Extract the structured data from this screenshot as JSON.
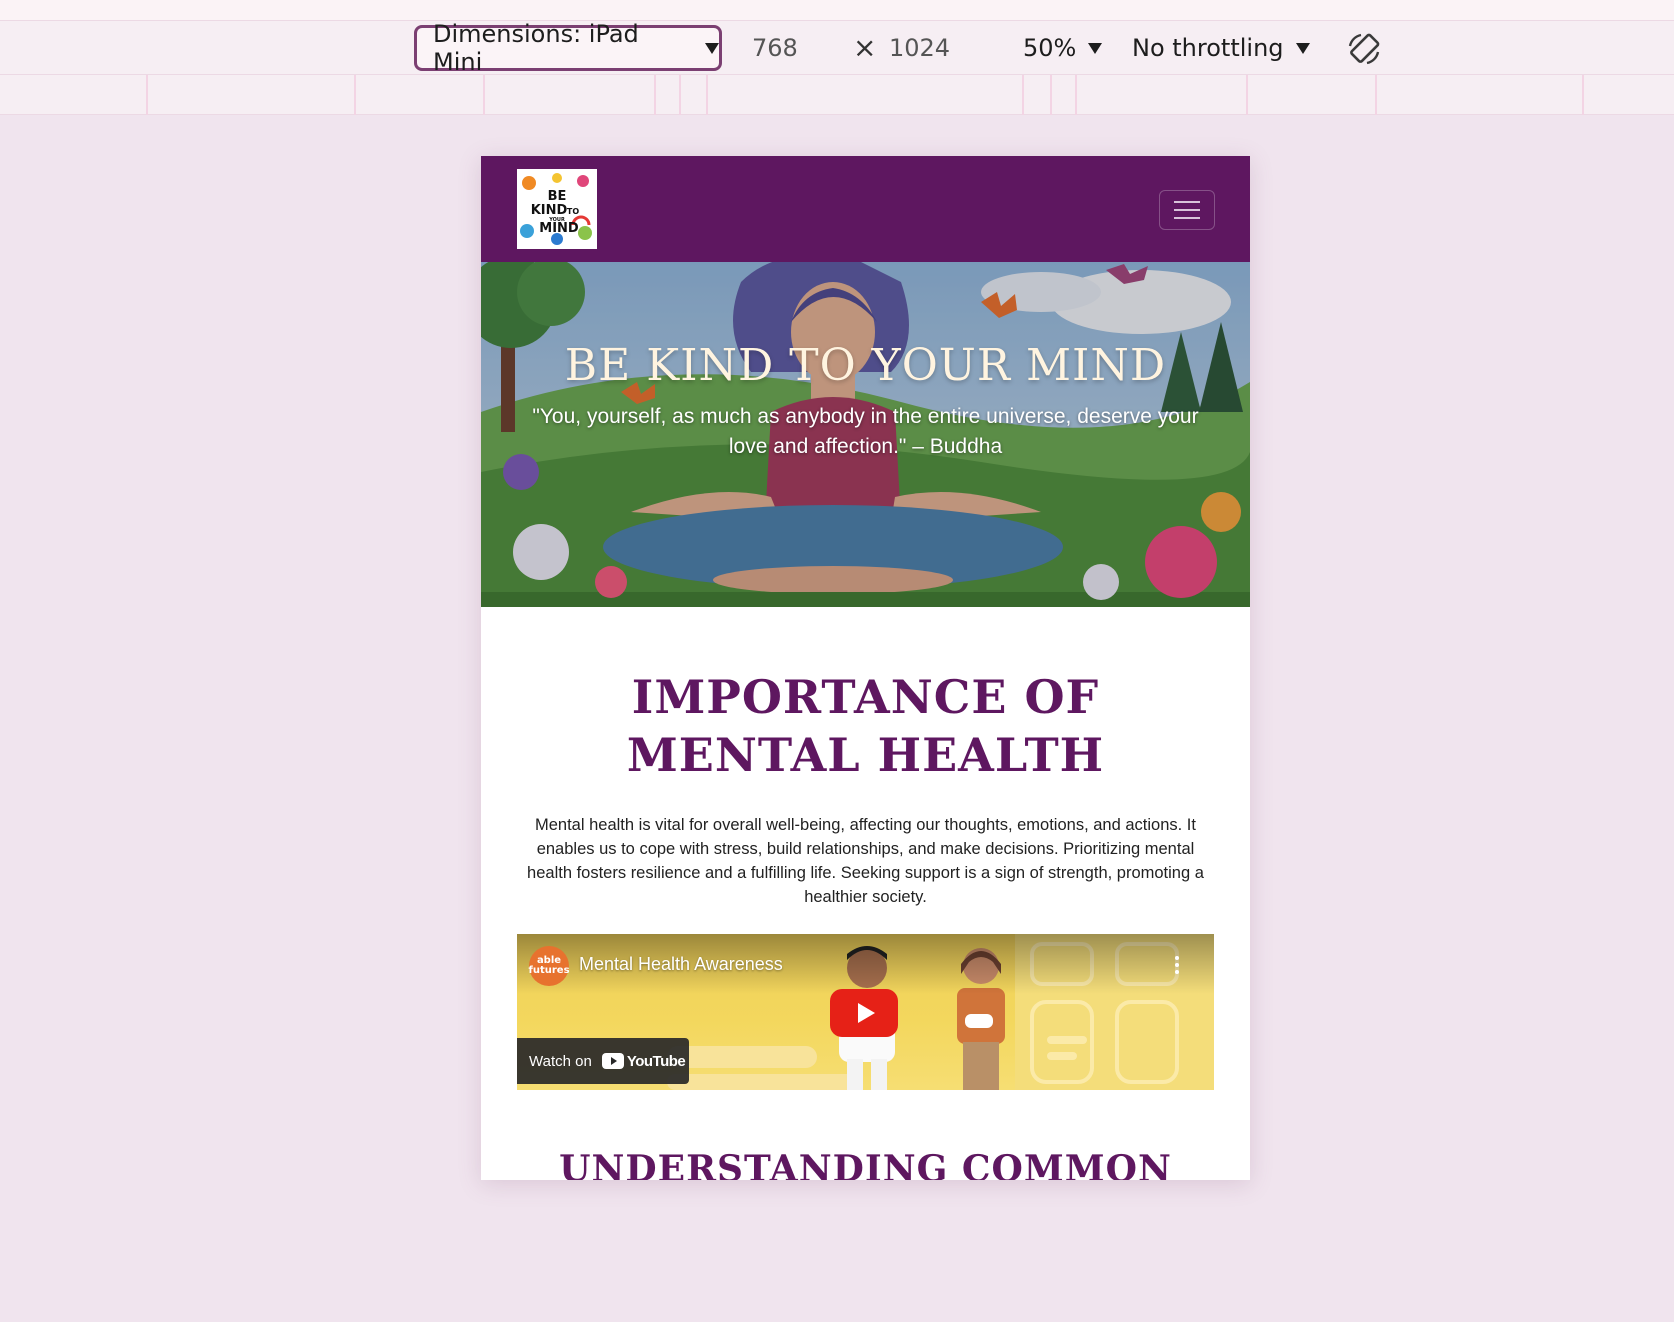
{
  "devtools": {
    "dimensions_label": "Dimensions: iPad Mini",
    "width_value": "768",
    "height_value": "1024",
    "times_symbol": "×",
    "zoom_label": "50%",
    "throttling_label": "No throttling",
    "rotate_icon": "rotate-icon"
  },
  "site": {
    "logo_alt": "BE KIND TO YOUR MIND",
    "logo_lines": [
      "BE",
      "KIND",
      "TO",
      "YOUR",
      "MIND"
    ],
    "hero": {
      "title": "BE KIND TO YOUR MIND",
      "quote": "\"You, yourself, as much as anybody in the entire universe, deserve your love and affection.\" – Buddha"
    },
    "section1": {
      "title": "IMPORTANCE OF MENTAL HEALTH",
      "body": "Mental health is vital for overall well-being, affecting our thoughts, emotions, and actions. It enables us to cope with stress, build relationships, and make decisions. Prioritizing mental health fosters resilience and a fulfilling life. Seeking support is a sign of strength, promoting a healthier society."
    },
    "video": {
      "channel_line1": "able",
      "channel_line2": "futures",
      "title": "Mental Health Awareness",
      "watch_on": "Watch on",
      "youtube": "YouTube"
    },
    "section2": {
      "title": "UNDERSTANDING COMMON MENTAL"
    }
  },
  "colors": {
    "brand_purple": "#5e1760",
    "hero_text": "#fff4e0",
    "play_red": "#e62117"
  }
}
